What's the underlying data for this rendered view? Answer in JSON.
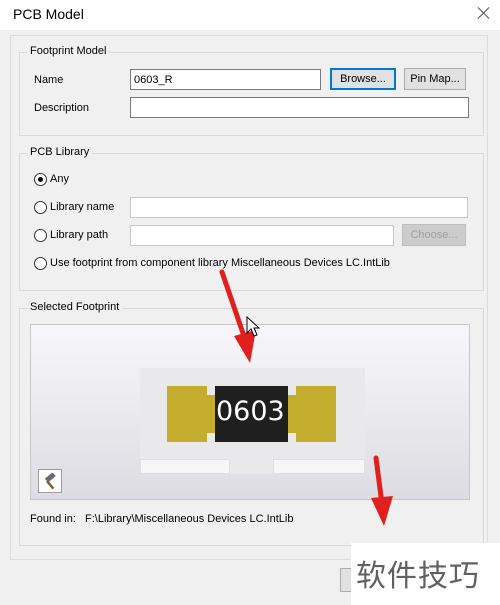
{
  "window": {
    "title": "PCB Model"
  },
  "footprint_model": {
    "group_title": "Footprint Model",
    "name_label": "Name",
    "name_value": "0603_R",
    "description_label": "Description",
    "description_value": "",
    "browse_label": "Browse...",
    "pin_map_label": "Pin Map..."
  },
  "pcb_library": {
    "group_title": "PCB Library",
    "options": {
      "any": "Any",
      "library_name": "Library name",
      "library_path": "Library path",
      "component_library": "Use footprint from component library Miscellaneous Devices LC.IntLib"
    },
    "selected": "any",
    "library_name_value": "",
    "library_path_value": "",
    "choose_label": "Choose..."
  },
  "selected_footprint": {
    "group_title": "Selected Footprint",
    "designator": "0603",
    "found_in_label": "Found in:",
    "found_in_path": "F:\\Library\\Miscellaneous Devices LC.IntLib"
  },
  "watermark": {
    "text": "软件技巧"
  },
  "colors": {
    "pad": "#c4ac2c",
    "body": "#1f1f1f",
    "arrow": "#e0201c",
    "accent": "#0078d7"
  }
}
